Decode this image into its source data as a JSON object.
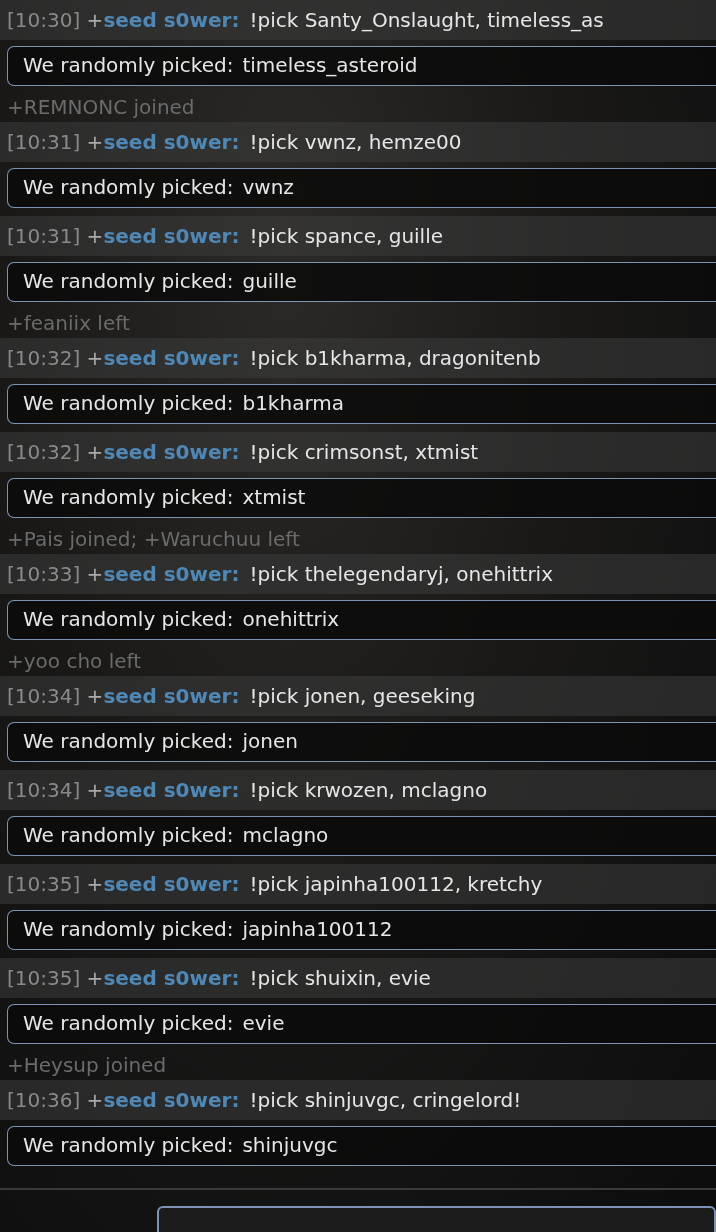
{
  "entries": [
    {
      "kind": "chat",
      "time": "[10:30]",
      "rank": "+",
      "user": "seed s0wer:",
      "message": "!pick Santy_Onslaught, timeless_as"
    },
    {
      "kind": "result",
      "label": "We randomly picked:",
      "value": "timeless_asteroid"
    },
    {
      "kind": "notice",
      "text": "+REMNONC joined"
    },
    {
      "kind": "chat",
      "time": "[10:31]",
      "rank": "+",
      "user": "seed s0wer:",
      "message": "!pick vwnz, hemze00"
    },
    {
      "kind": "result",
      "label": "We randomly picked:",
      "value": "vwnz"
    },
    {
      "kind": "chat",
      "time": "[10:31]",
      "rank": "+",
      "user": "seed s0wer:",
      "message": "!pick spance, guille"
    },
    {
      "kind": "result",
      "label": "We randomly picked:",
      "value": "guille"
    },
    {
      "kind": "notice",
      "text": "+feaniix left"
    },
    {
      "kind": "chat",
      "time": "[10:32]",
      "rank": "+",
      "user": "seed s0wer:",
      "message": "!pick b1kharma, dragonitenb"
    },
    {
      "kind": "result",
      "label": "We randomly picked:",
      "value": "b1kharma"
    },
    {
      "kind": "chat",
      "time": "[10:32]",
      "rank": "+",
      "user": "seed s0wer:",
      "message": "!pick crimsonst, xtmist"
    },
    {
      "kind": "result",
      "label": "We randomly picked:",
      "value": "xtmist"
    },
    {
      "kind": "notice",
      "text": "+Pais joined; +Waruchuu left"
    },
    {
      "kind": "chat",
      "time": "[10:33]",
      "rank": "+",
      "user": "seed s0wer:",
      "message": "!pick thelegendaryj, onehittrix"
    },
    {
      "kind": "result",
      "label": "We randomly picked:",
      "value": "onehittrix"
    },
    {
      "kind": "notice",
      "text": "+yoo cho left"
    },
    {
      "kind": "chat",
      "time": "[10:34]",
      "rank": "+",
      "user": "seed s0wer:",
      "message": "!pick jonen, geeseking"
    },
    {
      "kind": "result",
      "label": "We randomly picked:",
      "value": "jonen"
    },
    {
      "kind": "chat",
      "time": "[10:34]",
      "rank": "+",
      "user": "seed s0wer:",
      "message": "!pick krwozen, mclagno"
    },
    {
      "kind": "result",
      "label": "We randomly picked:",
      "value": "mclagno"
    },
    {
      "kind": "chat",
      "time": "[10:35]",
      "rank": "+",
      "user": "seed s0wer:",
      "message": "!pick japinha100112, kretchy"
    },
    {
      "kind": "result",
      "label": "We randomly picked:",
      "value": "japinha100112"
    },
    {
      "kind": "chat",
      "time": "[10:35]",
      "rank": "+",
      "user": "seed s0wer:",
      "message": "!pick shuixin, evie"
    },
    {
      "kind": "result",
      "label": "We randomly picked:",
      "value": "evie"
    },
    {
      "kind": "notice",
      "text": "+Heysup joined"
    },
    {
      "kind": "chat",
      "time": "[10:36]",
      "rank": "+",
      "user": "seed s0wer:",
      "message": "!pick shinjuvgc, cringelord!"
    },
    {
      "kind": "result",
      "label": "We randomly picked:",
      "value": "shinjuvgc"
    }
  ]
}
